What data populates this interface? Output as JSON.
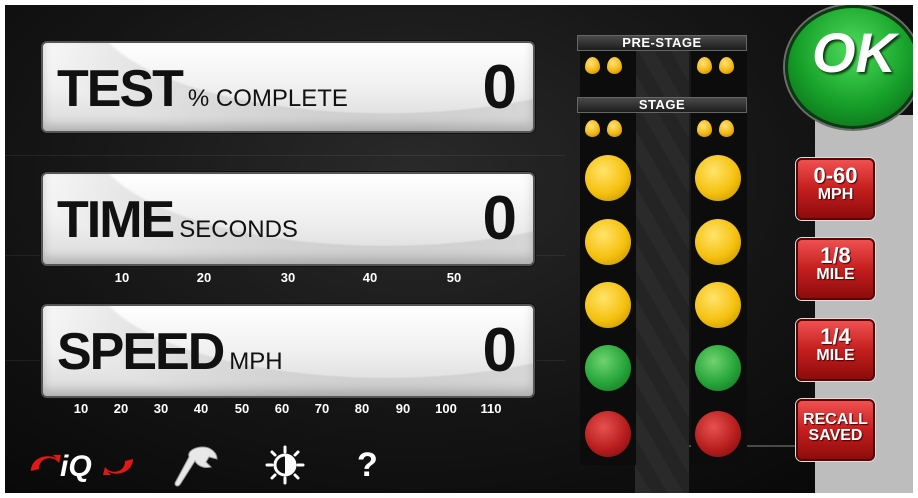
{
  "panels": {
    "test": {
      "title": "TEST",
      "unit": "% COMPLETE",
      "value": "0"
    },
    "time": {
      "title": "TIME",
      "unit": "SECONDS",
      "value": "0"
    },
    "speed": {
      "title": "SPEED",
      "unit": "MPH",
      "value": "0"
    }
  },
  "time_scale": [
    "10",
    "20",
    "30",
    "40",
    "50"
  ],
  "speed_scale": [
    "10",
    "20",
    "30",
    "40",
    "50",
    "60",
    "70",
    "80",
    "90",
    "100",
    "110"
  ],
  "tree": {
    "prestage_label": "PRE-STAGE",
    "stage_label": "STAGE"
  },
  "buttons": {
    "ok": "OK",
    "zero_sixty": {
      "l1": "0-60",
      "l2": "MPH"
    },
    "eighth_mile": {
      "l1": "1/8",
      "l2": "MILE"
    },
    "quarter_mile": {
      "l1": "1/4",
      "l2": "MILE"
    },
    "recall": {
      "l1": "RECALL",
      "l2": "SAVED"
    }
  },
  "toolbar": {
    "logo_text": "iQ",
    "help": "?"
  },
  "icons": [
    "iq-logo-icon",
    "wrench-icon",
    "brightness-icon",
    "help-icon"
  ],
  "colors": {
    "ok_green": "#16a02a",
    "button_red": "#c41e1e",
    "bulb_yellow": "#f5c10f",
    "bulb_green": "#27a53a",
    "bulb_red": "#b81e1e"
  }
}
